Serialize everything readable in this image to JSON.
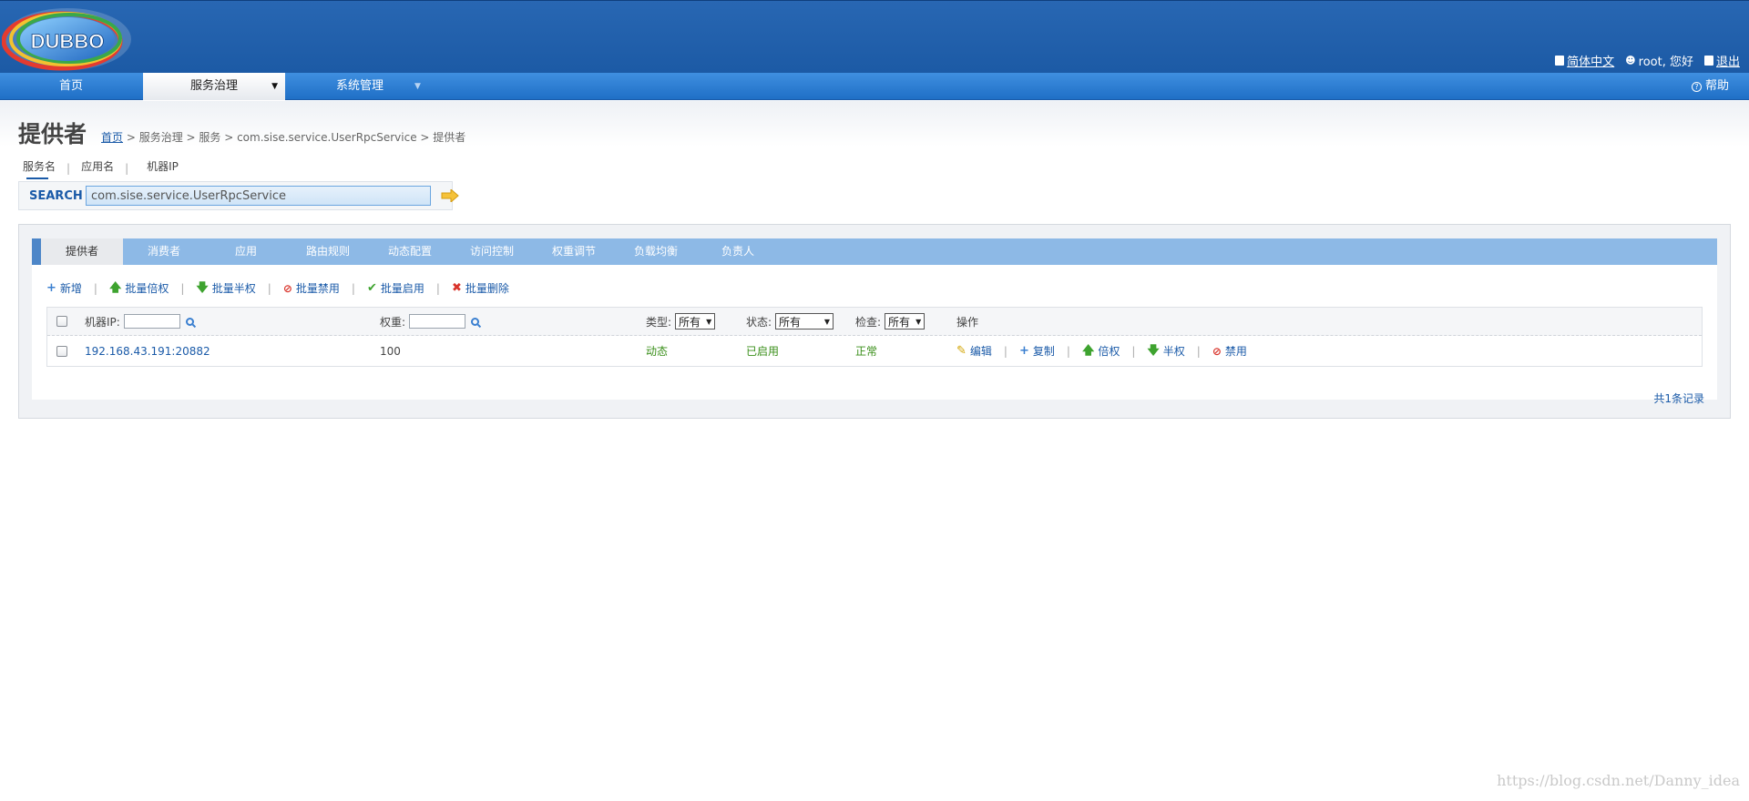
{
  "brand": {
    "logo_text": "DUBBO"
  },
  "top_links": {
    "language": "简体中文",
    "user": "root, 您好",
    "logout": "退出"
  },
  "nav": {
    "items": [
      {
        "label": "首页"
      },
      {
        "label": "服务治理"
      },
      {
        "label": "系统管理"
      }
    ],
    "help": "帮助"
  },
  "page": {
    "title": "提供者"
  },
  "breadcrumb": {
    "home": "首页",
    "rest": " > 服务治理 > 服务 > com.sise.service.UserRpcService > 提供者"
  },
  "search_tabs": {
    "items": [
      "服务名",
      "应用名",
      "机器IP"
    ]
  },
  "search": {
    "label": "SEARCH",
    "value": "com.sise.service.UserRpcService"
  },
  "tabs": [
    "提供者",
    "消费者",
    "应用",
    "路由规则",
    "动态配置",
    "访问控制",
    "权重调节",
    "负载均衡",
    "负责人"
  ],
  "actions": [
    "新增",
    "批量倍权",
    "批量半权",
    "批量禁用",
    "批量启用",
    "批量删除"
  ],
  "table": {
    "headers": {
      "ip": "机器IP:",
      "weight": "权重:",
      "type": "类型:",
      "status": "状态:",
      "check": "检查:",
      "ops": "操作"
    },
    "filters": {
      "type": "所有",
      "status": "所有",
      "check": "所有"
    },
    "rows": [
      {
        "ip": "192.168.43.191:20882",
        "weight": "100",
        "type": "动态",
        "status": "已启用",
        "check": "正常",
        "ops": [
          "编辑",
          "复制",
          "倍权",
          "半权",
          "禁用"
        ]
      }
    ]
  },
  "record_count": "共1条记录",
  "watermark": "https://blog.csdn.net/Danny_idea",
  "colors": {
    "header": "#1c5aa5",
    "nav": "#2a7ad0",
    "tab_bar": "#8db9e6",
    "link": "#1a5aa8",
    "ok_green": "#3a8f1a"
  }
}
